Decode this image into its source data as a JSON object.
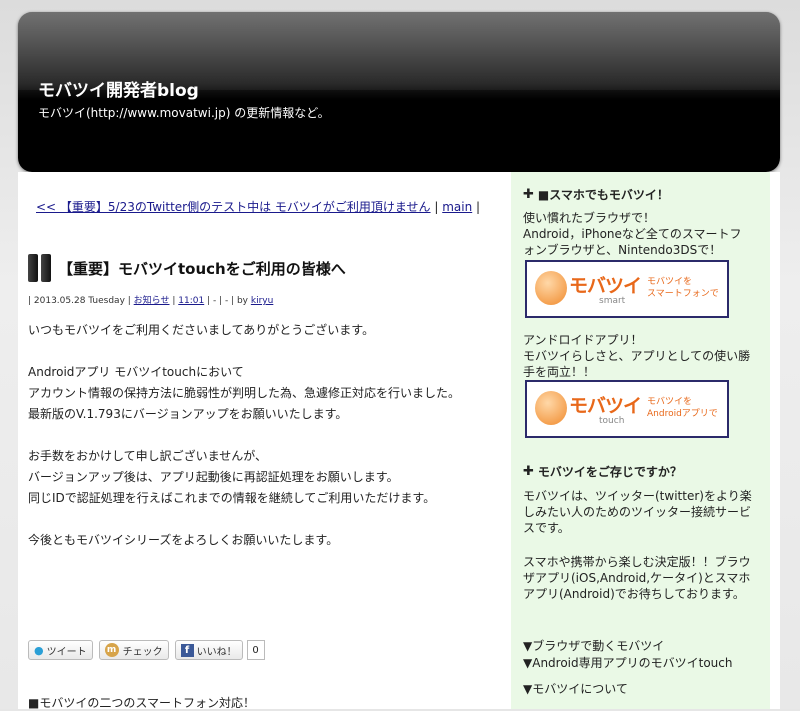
{
  "header": {
    "title": "モバツイ開発者blog",
    "description": "モバツイ(http://www.movatwi.jp) の更新情報など。"
  },
  "post_nav": {
    "prev_link": "<< 【重要】5/23のTwitter側のテスト中は モバツイがご利用頂けません",
    "separator1": " | ",
    "main_link": "main",
    "separator2": " |"
  },
  "post": {
    "title": "【重要】モバツイtouchをご利用の皆様へ",
    "meta_date": "| 2013.05.28 Tuesday |",
    "meta_category": "お知らせ",
    "meta_sep1": " | ",
    "meta_time": "11:01",
    "meta_rest": " | - | - | by ",
    "meta_author": "kiryu",
    "paragraphs": [
      "いつもモバツイをご利用くださいましてありがとうございます。",
      "Androidアプリ モバツイtouchにおいて\nアカウント情報の保持方法に脆弱性が判明した為、急遽修正対応を行いました。\n最新版のV.1.793にバージョンアップをお願いいたします。",
      "お手数をおかけして申し訳ございませんが、\nバージョンアップ後は、アプリ起動後に再認証処理をお願いします。\n同じIDで認証処理を行えばこれまでの情報を継続してご利用いただけます。",
      "今後ともモバツイシリーズをよろしくお願いいたします。"
    ],
    "next_section": "■モバツイの二つのスマートフォン対応！"
  },
  "social": {
    "tweet_label": "ツイート",
    "mixi_label": "チェック",
    "facebook_label": "いいね！",
    "facebook_count": "0"
  },
  "sidebar": {
    "section1_title": "■スマホでもモバツイ！",
    "section1_text1": "使い慣れたブラウザで！\nAndroid，iPhoneなど全てのスマートフォンブラウザと、Nintendo3DSで！",
    "banner1": {
      "logo": "モバツイ",
      "sub": "smart",
      "tag": "モバツイを\nスマートフォンで"
    },
    "section1_text2": "アンドロイドアプリ！\nモバツイらしさと、アプリとしての使い勝手を両立！！",
    "banner2": {
      "logo": "モバツイ",
      "sub": "touch",
      "tag": "モバツイを\nAndroidアプリで"
    },
    "section2_title": "モバツイをご存じですか？",
    "section2_text1": "モバツイは、ツイッター(twitter)をより楽しみたい人のためのツイッター接続サービスです。",
    "section2_text2": "スマホや携帯から楽しむ決定版！！ブラウザアプリ(iOS,Android,ケータイ)とスマホアプリ(Android)でお待ちしております。",
    "link1": "▼ブラウザで動くモバツイ",
    "link2": "▼Android専用アプリのモバツイtouch",
    "link3": "▼モバツイについて"
  },
  "colors": {
    "header_bg": "#000000",
    "sidebar_bg": "#eaf9e6",
    "link": "#1a1a8c",
    "brand_orange": "#e8681a"
  }
}
